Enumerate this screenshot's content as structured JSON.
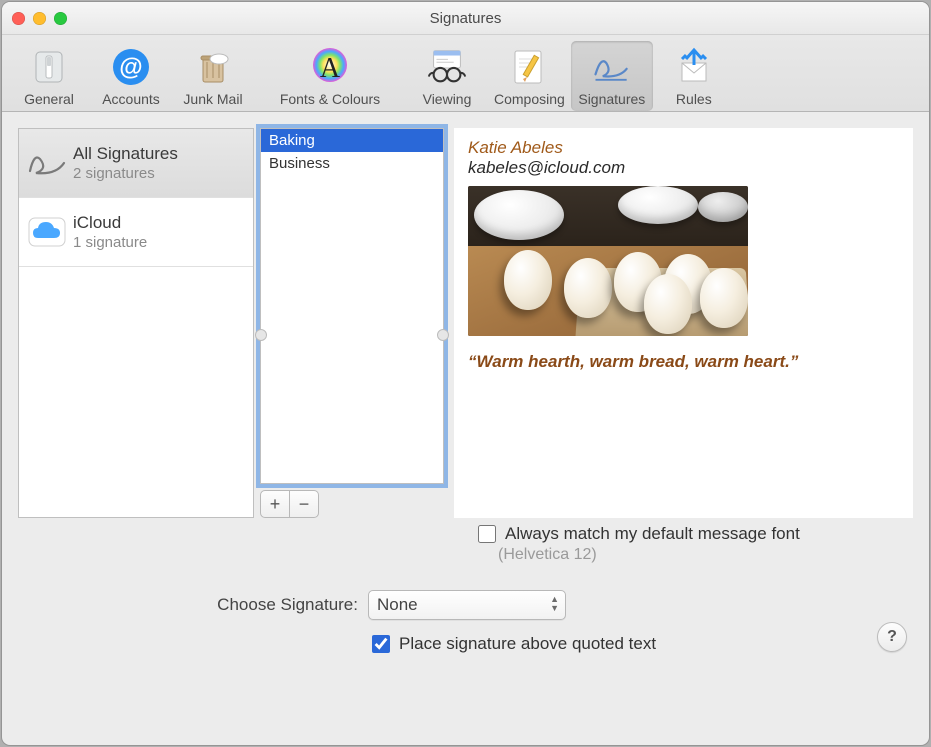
{
  "window": {
    "title": "Signatures"
  },
  "toolbar": {
    "items": [
      {
        "label": "General"
      },
      {
        "label": "Accounts"
      },
      {
        "label": "Junk Mail"
      },
      {
        "label": "Fonts & Colours"
      },
      {
        "label": "Viewing"
      },
      {
        "label": "Composing"
      },
      {
        "label": "Signatures"
      },
      {
        "label": "Rules"
      }
    ],
    "active_index": 6
  },
  "accounts": [
    {
      "name": "All Signatures",
      "sub": "2 signatures",
      "icon": "signature",
      "selected": true
    },
    {
      "name": "iCloud",
      "sub": "1 signature",
      "icon": "icloud",
      "selected": false
    }
  ],
  "signatures": [
    {
      "name": "Baking",
      "selected": true
    },
    {
      "name": "Business",
      "selected": false
    }
  ],
  "preview": {
    "from_name": "Katie Abeles",
    "email": "kabeles@icloud.com",
    "quote": "“Warm hearth, warm bread, warm heart.”"
  },
  "options": {
    "always_match_font_label": "Always match my default message font",
    "always_match_font_checked": false,
    "font_description": "(Helvetica 12)",
    "choose_signature_label": "Choose Signature:",
    "choose_signature_value": "None",
    "place_above_label": "Place signature above quoted text",
    "place_above_checked": true
  },
  "buttons": {
    "plus": "+",
    "minus": "−",
    "help": "?"
  },
  "colors": {
    "accent": "#2a68d8",
    "quote": "#8a4a18",
    "name": "#a05a1a"
  }
}
